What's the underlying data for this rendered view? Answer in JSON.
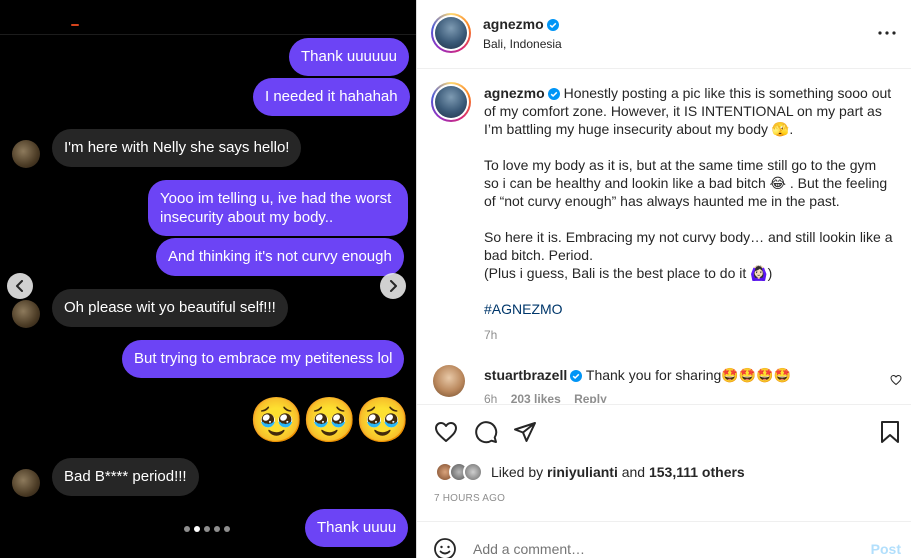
{
  "chat": {
    "messages": [
      {
        "side": "out",
        "text": "Thank uuuuuu"
      },
      {
        "side": "out",
        "text": "I needed it hahahah"
      },
      {
        "side": "in",
        "text": "I'm here with Nelly she says hello!"
      },
      {
        "side": "out",
        "text": "Yooo im telling u, ive had the worst insecurity about my body.."
      },
      {
        "side": "out",
        "text": "And thinking it's not curvy enough"
      },
      {
        "side": "in",
        "text": "Oh please wit yo beautiful self!!!"
      },
      {
        "side": "out",
        "text": "But trying to embrace my petiteness lol"
      },
      {
        "side": "out",
        "text": "🥹🥹🥹"
      },
      {
        "side": "in",
        "text": "Bad B**** period!!!"
      },
      {
        "side": "out",
        "text": "Thank uuuu"
      }
    ],
    "emojis": [
      "🥹",
      "🥹",
      "🥹"
    ],
    "carousel_dot_count": 5,
    "carousel_active_index": 1
  },
  "post": {
    "author": "agnezmo",
    "location": "Bali, Indonesia",
    "caption_paragraphs": [
      "Honestly posting a pic like this is something sooo out of my comfort zone. However, it IS INTENTIONAL on my part as I’m battling my huge insecurity about my body 🫣.",
      "To love my body as it is, but at the same time still go to the gym so i can be healthy and lookin like a bad bitch 😂 . But the feeling of “not curvy enough” has always haunted me in the past.",
      "So here it is. Embracing my not curvy body… and still lookin like a bad bitch. Period.",
      "(Plus i guess, Bali is the best place to do it 🙆🏻‍♀️)"
    ],
    "hashtag": "#AGNEZMO",
    "caption_time": "7h",
    "comment": {
      "user": "stuartbrazell",
      "text": "Thank you for sharing🤩🤩🤩🤩",
      "time": "6h",
      "likes": "203 likes",
      "reply": "Reply"
    },
    "liked_by_prefix": "Liked by ",
    "liked_by_user": "riniyulianti",
    "liked_by_middle": " and ",
    "liked_by_count": "153,111 others",
    "timestamp": "7 HOURS AGO",
    "comment_placeholder": "Add a comment…",
    "post_button": "Post"
  },
  "colors": {
    "outgoing_bubble": "#6c44f5",
    "incoming_bubble": "#262626",
    "verified": "#0095f6",
    "hashtag": "#00376b",
    "post_button_disabled": "#b2dffc"
  },
  "icons": [
    "chevron-left-icon",
    "chevron-right-icon",
    "more-icon",
    "verified-badge-icon",
    "heart-icon",
    "comment-icon",
    "share-icon",
    "bookmark-icon",
    "emoji-icon"
  ]
}
